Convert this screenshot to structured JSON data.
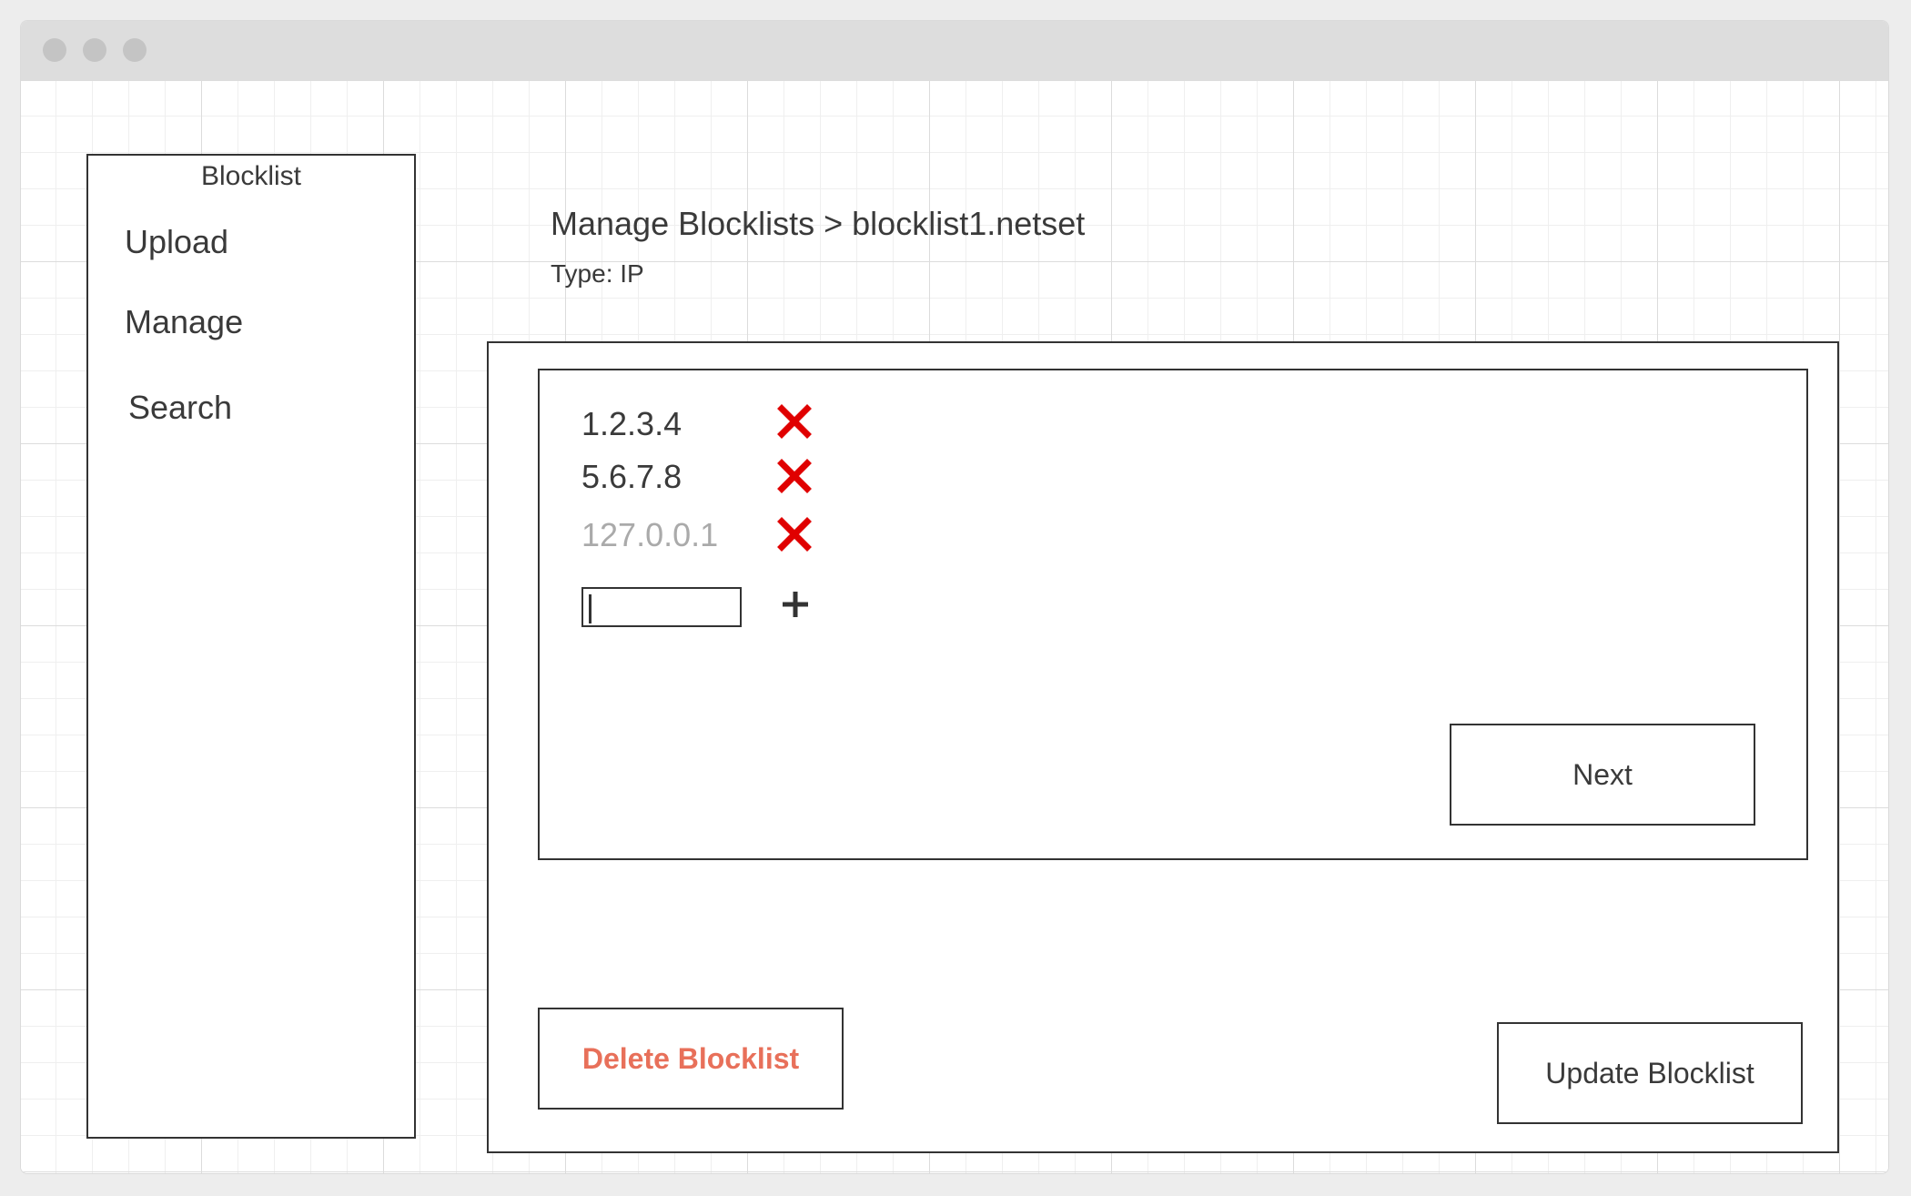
{
  "window": {
    "titlebar_dots": 3
  },
  "sidebar": {
    "title": "Blocklist",
    "items": [
      {
        "label": "Upload"
      },
      {
        "label": "Manage"
      },
      {
        "label": "Search"
      }
    ]
  },
  "header": {
    "breadcrumb": "Manage Blocklists > blocklist1.netset",
    "type_label": "Type: IP"
  },
  "entries": [
    {
      "value": "1.2.3.4",
      "muted": false,
      "icon": "close-icon"
    },
    {
      "value": "5.6.7.8",
      "muted": false,
      "icon": "close-icon"
    },
    {
      "value": "127.0.0.1",
      "muted": true,
      "icon": "close-icon"
    }
  ],
  "new_entry": {
    "value": "",
    "add_icon": "plus-icon"
  },
  "buttons": {
    "next": "Next",
    "delete": "Delete Blocklist",
    "update": "Update Blocklist"
  },
  "colors": {
    "remove_icon": "#e00000",
    "delete_text": "#e8705a",
    "muted_text": "#aaaaaa"
  }
}
